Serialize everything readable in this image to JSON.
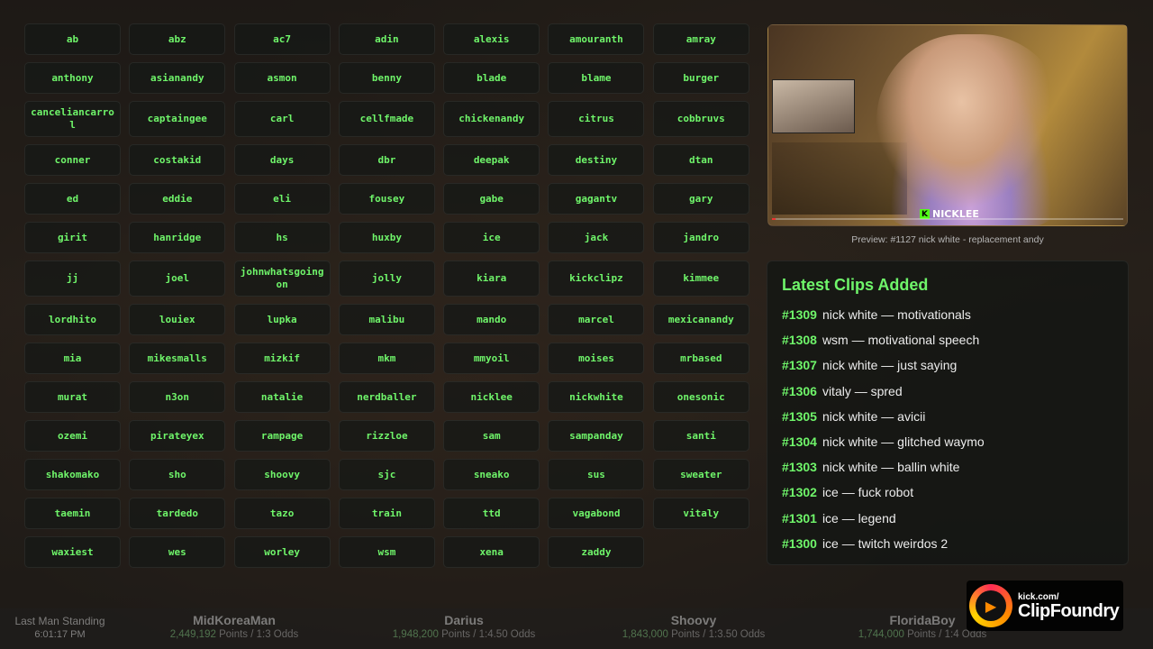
{
  "tags": [
    "ab",
    "abz",
    "ac7",
    "adin",
    "alexis",
    "amouranth",
    "amray",
    "anthony",
    "asianandy",
    "asmon",
    "benny",
    "blade",
    "blame",
    "burger",
    "canceliancarrol",
    "captaingee",
    "carl",
    "cellfmade",
    "chickenandy",
    "citrus",
    "cobbruvs",
    "conner",
    "costakid",
    "days",
    "dbr",
    "deepak",
    "destiny",
    "dtan",
    "ed",
    "eddie",
    "eli",
    "fousey",
    "gabe",
    "gagantv",
    "gary",
    "girit",
    "hanridge",
    "hs",
    "huxby",
    "ice",
    "jack",
    "jandro",
    "jj",
    "joel",
    "johnwhatsgoingon",
    "jolly",
    "kiara",
    "kickclipz",
    "kimmee",
    "lordhito",
    "louiex",
    "lupka",
    "malibu",
    "mando",
    "marcel",
    "mexicanandy",
    "mia",
    "mikesmalls",
    "mizkif",
    "mkm",
    "mmyoil",
    "moises",
    "mrbased",
    "murat",
    "n3on",
    "natalie",
    "nerdballer",
    "nicklee",
    "nickwhite",
    "onesonic",
    "ozemi",
    "pirateyex",
    "rampage",
    "rizzloe",
    "sam",
    "sampanday",
    "santi",
    "shakomako",
    "sho",
    "shoovy",
    "sjc",
    "sneako",
    "sus",
    "sweater",
    "taemin",
    "tardedo",
    "tazo",
    "train",
    "ttd",
    "vagabond",
    "vitaly",
    "waxiest",
    "wes",
    "worley",
    "wsm",
    "xena",
    "zaddy"
  ],
  "preview": {
    "caption": "Preview: #1127 nick white - replacement andy",
    "watermark": "NICKLEE",
    "progress": 0.01
  },
  "clips": {
    "title": "Latest Clips Added",
    "items": [
      {
        "num": "#1309",
        "text": "nick white — motivationals"
      },
      {
        "num": "#1308",
        "text": "wsm — motivational speech"
      },
      {
        "num": "#1307",
        "text": "nick white — just saying"
      },
      {
        "num": "#1306",
        "text": "vitaly — spred"
      },
      {
        "num": "#1305",
        "text": "nick white — avicii"
      },
      {
        "num": "#1304",
        "text": "nick white — glitched waymo"
      },
      {
        "num": "#1303",
        "text": "nick white — ballin white"
      },
      {
        "num": "#1302",
        "text": "ice — fuck robot"
      },
      {
        "num": "#1301",
        "text": "ice — legend"
      },
      {
        "num": "#1300",
        "text": "ice — twitch weirdos 2"
      }
    ]
  },
  "standings": {
    "label": "Last Man Standing",
    "time": "6:01:17 PM",
    "entries": [
      {
        "name": "MidKoreaMan",
        "points": "2,449,192",
        "odds": "Points / 1:3 Odds"
      },
      {
        "name": "Darius",
        "points": "1,948,200",
        "odds": "Points / 1:4.50 Odds"
      },
      {
        "name": "Shoovy",
        "points": "1,843,000",
        "odds": "Points / 1:3.50 Odds"
      },
      {
        "name": "FloridaBoy",
        "points": "1,744,000",
        "odds": "Points / 1:4 Odds"
      }
    ]
  },
  "brand": {
    "small": "kick.com/",
    "big": "ClipFoundry"
  },
  "colors": {
    "accent_green": "#6ff56a",
    "kick_green": "#53fc18"
  }
}
